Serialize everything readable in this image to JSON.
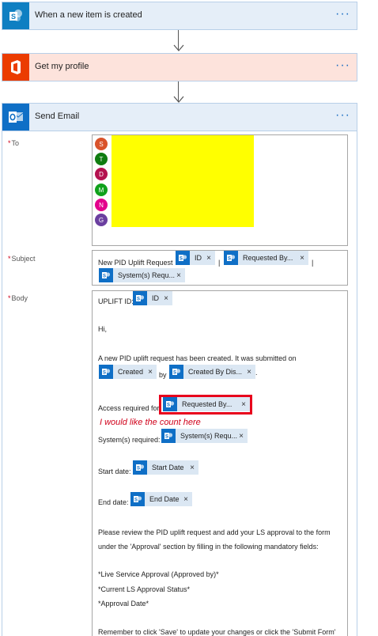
{
  "steps": [
    {
      "title": "When a new item is created",
      "color": "#0f7fc2",
      "bg": "#e5eef8",
      "icon": "sharepoint-icon"
    },
    {
      "title": "Get my profile",
      "color": "#eb3c00",
      "bg": "#fde3dc",
      "icon": "office-icon"
    },
    {
      "title": "Send Email",
      "color": "#0f6fc6",
      "bg": "#e5eef8",
      "icon": "outlook-icon"
    }
  ],
  "more_label": "···",
  "fields": {
    "to": "To",
    "subject": "Subject",
    "body": "Body"
  },
  "recipients": [
    {
      "initial": "S",
      "color": "#d9532b"
    },
    {
      "initial": "T",
      "color": "#107c10"
    },
    {
      "initial": "D",
      "color": "#b4124f"
    },
    {
      "initial": "M",
      "color": "#10a11b"
    },
    {
      "initial": "N",
      "color": "#e3008c"
    },
    {
      "initial": "G",
      "color": "#6b3fa0"
    }
  ],
  "subject": {
    "prefix": "New PID Uplift Request",
    "separator": "|",
    "tokens": [
      "ID",
      "Requested By...",
      "System(s) Requ..."
    ]
  },
  "body": {
    "uplift_label": "UPLIFT ID:",
    "uplift_token": "ID",
    "greeting": "Hi,",
    "intro": "A new PID uplift request has been created. It was submitted on",
    "created_token": "Created",
    "by": "by",
    "created_by_token": "Created By Dis...",
    "period": ".",
    "access_label": "Access required for",
    "access_token": "Requested By...",
    "systems_label": "System(s) required:",
    "systems_token": "System(s) Requ...",
    "start_label": "Start date:",
    "start_token": "Start Date",
    "end_label": "End date:",
    "end_token": "End Date",
    "review_1": "Please review the PID uplift request and add your LS approval to the form",
    "review_2": "under the 'Approval' section by filling in the following mandatory fields:",
    "req_1": "*Live Service Approval (Approved by)*",
    "req_2": "*Current LS Approval Status*",
    "req_3": "*Approval Date*",
    "reminder": "Remember to click 'Save' to update your changes or click the 'Submit Form'"
  },
  "annotation": {
    "note": "I would like the count here",
    "highlight_color": "#e8001c"
  },
  "close_glyph": "×",
  "required_mark": "*"
}
